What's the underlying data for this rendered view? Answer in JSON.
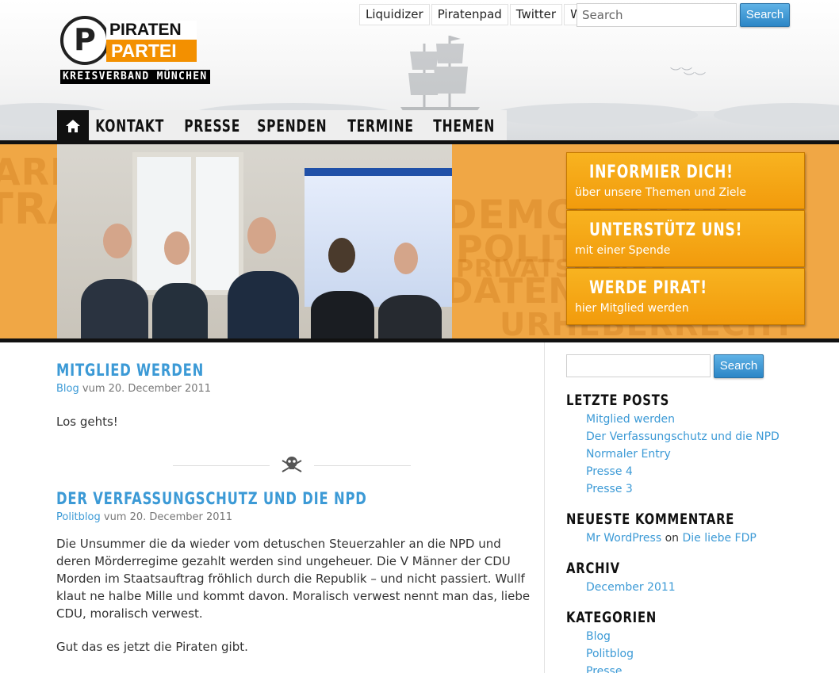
{
  "site": {
    "logo_top": "PIRATEN",
    "logo_bottom": "PARTEI",
    "logo_sub": "KREISVERBAND MÜNCHEN"
  },
  "toplinks": [
    "Liquidizer",
    "Piratenpad",
    "Twitter",
    "Wiki"
  ],
  "search": {
    "placeholder": "Search",
    "button": "Search"
  },
  "nav": {
    "items": [
      "KONTAKT",
      "PRESSE",
      "SPENDEN",
      "TERMINE",
      "THEMEN"
    ]
  },
  "banner": {
    "background_words": [
      "ARENZ FREIHEIT",
      "TRANSPARENZ",
      "DEMOKRATIE",
      "POLITIK",
      "PRIVATSPHÄRE",
      "DATENSCHUTZ",
      "URHEBERRECHT"
    ],
    "cta": [
      {
        "title": "INFORMIER DICH!",
        "subtitle": "über unsere Themen und Ziele"
      },
      {
        "title": "UNTERSTÜTZ UNS!",
        "subtitle": "mit einer Spende"
      },
      {
        "title": "WERDE PIRAT!",
        "subtitle": "hier Mitglied werden"
      }
    ]
  },
  "posts": [
    {
      "title": "MITGLIED WERDEN",
      "category": "Blog",
      "date": "vum 20. December 2011",
      "paragraphs": [
        "Los gehts!"
      ]
    },
    {
      "title": "DER VERFASSUNGSCHUTZ UND DIE NPD",
      "category": "Politblog",
      "date": "vum 20. December 2011",
      "paragraphs": [
        "Die Unsummer die da wieder vom detuschen Steuerzahler an die NPD und deren Mörderregime gezahlt werden sind ungeheuer. Die V Männer der CDU Morden im Staatsauftrag fröhlich durch die Republik – und nicht passiert. Wullf klaut ne halbe Mille und kommt davon. Moralisch verwest nennt man das, liebe CDU, moralisch verwest.",
        "Gut das es jetzt die Piraten gibt."
      ]
    }
  ],
  "sidebar": {
    "search_button": "Search",
    "recent_title": "LETZTE POSTS",
    "recent": [
      "Mitglied werden",
      "Der Verfassungschutz und die NPD",
      "Normaler Entry",
      "Presse 4",
      "Presse 3"
    ],
    "comments_title": "NEUESTE KOMMENTARE",
    "comment": {
      "author": "Mr WordPress",
      "on": "on",
      "post": "Die liebe FDP"
    },
    "archive_title": "ARCHIV",
    "archive": [
      "December 2011"
    ],
    "categories_title": "KATEGORIEN",
    "categories": [
      "Blog",
      "Politblog",
      "Presse"
    ]
  },
  "colors": {
    "accent": "#3c9ad6",
    "orange": "#f29b0c",
    "banner": "#f0a745"
  }
}
